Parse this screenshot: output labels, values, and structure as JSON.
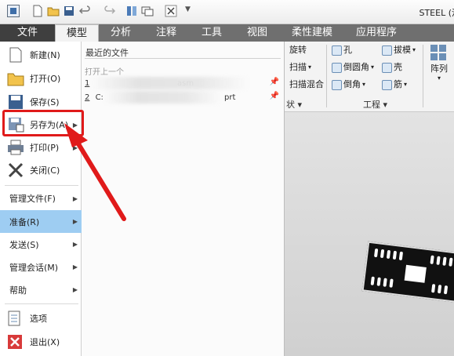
{
  "window": {
    "title": "STEEL (活"
  },
  "tabs": [
    {
      "label": "文件"
    },
    {
      "label": "模型"
    },
    {
      "label": "分析"
    },
    {
      "label": "注释"
    },
    {
      "label": "工具"
    },
    {
      "label": "视图"
    },
    {
      "label": "柔性建模"
    },
    {
      "label": "应用程序"
    }
  ],
  "active_tab": "模型",
  "ribbon": {
    "buttons": {
      "rotate": "旋转",
      "sweep": "扫描",
      "swept_blend": "扫描混合",
      "hole": "孔",
      "round": "倒圆角",
      "chamfer": "倒角",
      "draft": "拔模",
      "shell": "壳",
      "rib": "筋",
      "pattern": "阵列"
    },
    "groups": {
      "shapes_tail": "状 ▾",
      "engineering": "工程 ▾"
    }
  },
  "file_menu": {
    "items": [
      {
        "label": "新建(N)",
        "icon": "new-file-icon"
      },
      {
        "label": "打开(O)",
        "icon": "open-folder-icon"
      },
      {
        "label": "保存(S)",
        "icon": "save-icon"
      },
      {
        "label": "另存为(A)",
        "icon": "save-as-icon",
        "submenu": true
      },
      {
        "label": "打印(P)",
        "icon": "print-icon",
        "submenu": true
      },
      {
        "label": "关闭(C)",
        "icon": "close-icon"
      }
    ],
    "text_items": [
      {
        "label": "管理文件(F)",
        "submenu": true
      },
      {
        "label": "准备(R)",
        "submenu": true
      },
      {
        "label": "发送(S)",
        "submenu": true
      },
      {
        "label": "管理会话(M)",
        "submenu": true
      },
      {
        "label": "帮助",
        "submenu": true
      }
    ],
    "bottom_items": [
      {
        "label": "选项",
        "icon": "options-icon"
      },
      {
        "label": "退出(X)",
        "icon": "exit-icon"
      }
    ]
  },
  "recent_files": {
    "header": "最近的文件",
    "open_last": "打开上一个",
    "files": [
      {
        "index": "1",
        "name": "asm"
      },
      {
        "index": "2",
        "name": "C:",
        "tail": "prt"
      }
    ]
  },
  "colors": {
    "highlight": "#9ecdf2",
    "annotation": "#e01a1a",
    "tab_bar": "#6f6f6f"
  }
}
